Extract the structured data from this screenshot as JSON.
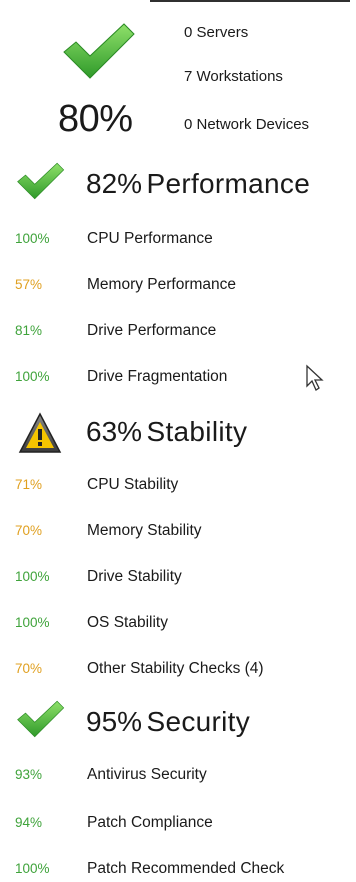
{
  "summary": {
    "score": "80%",
    "icon": "check-icon",
    "counts": [
      {
        "label": "0 Servers"
      },
      {
        "label": "7 Workstations"
      },
      {
        "label": "0 Network Devices"
      }
    ]
  },
  "sections": [
    {
      "name": "performance",
      "icon": "check-icon",
      "percent": "82%",
      "title": "Performance",
      "rows": [
        {
          "percent": "100%",
          "label": "CPU Performance",
          "status": "good"
        },
        {
          "percent": "57%",
          "label": "Memory Performance",
          "status": "warn"
        },
        {
          "percent": "81%",
          "label": "Drive Performance",
          "status": "good"
        },
        {
          "percent": "100%",
          "label": "Drive Fragmentation",
          "status": "good"
        }
      ]
    },
    {
      "name": "stability",
      "icon": "warning-icon",
      "percent": "63%",
      "title": "Stability",
      "rows": [
        {
          "percent": "71%",
          "label": "CPU Stability",
          "status": "warn"
        },
        {
          "percent": "70%",
          "label": "Memory Stability",
          "status": "warn"
        },
        {
          "percent": "100%",
          "label": "Drive Stability",
          "status": "good"
        },
        {
          "percent": "100%",
          "label": "OS Stability",
          "status": "good"
        },
        {
          "percent": "70%",
          "label": "Other Stability Checks (4)",
          "status": "warn"
        }
      ]
    },
    {
      "name": "security",
      "icon": "check-icon",
      "percent": "95%",
      "title": "Security",
      "rows": [
        {
          "percent": "93%",
          "label": "Antivirus Security",
          "status": "good"
        },
        {
          "percent": "94%",
          "label": "Patch Compliance",
          "status": "good"
        },
        {
          "percent": "100%",
          "label": "Patch Recommended Check",
          "status": "good"
        }
      ]
    }
  ],
  "colors": {
    "good": "#3fa33b",
    "warn": "#e0a020"
  }
}
